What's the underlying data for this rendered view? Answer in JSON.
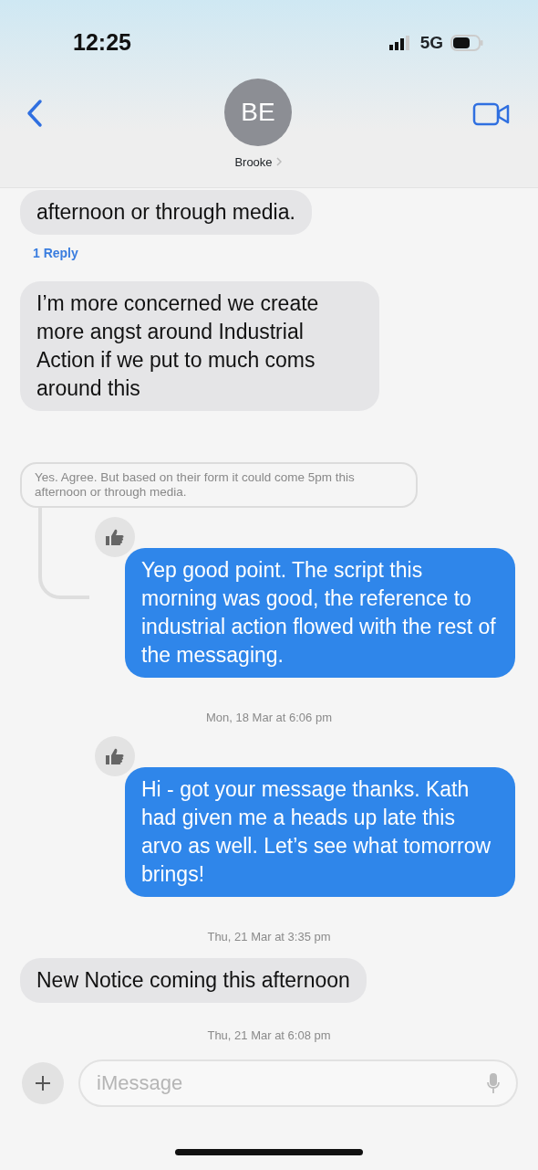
{
  "status_bar": {
    "time": "12:25",
    "network": "5G"
  },
  "header": {
    "initials": "BE",
    "name": "Brooke"
  },
  "messages": [
    {
      "kind": "received",
      "text": "afternoon or through media.",
      "reply_count": "1 Reply",
      "tapback": false,
      "threaded": false
    },
    {
      "kind": "received",
      "text": "I’m more concerned we create more angst around Industrial Action if we put to much coms around this",
      "tapback": false,
      "threaded": false
    },
    {
      "kind": "quote",
      "text": "Yes. Agree. But based on their form it could come 5pm this afternoon or through media."
    },
    {
      "kind": "sent",
      "text": "Yep good point. The script this morning was good, the reference to industrial action flowed with the rest of the messaging.",
      "tapback": true,
      "threaded": true
    },
    {
      "kind": "timestamp",
      "text": "Mon, 18 Mar at 6:06 pm"
    },
    {
      "kind": "sent",
      "text": "Hi - got your message thanks. Kath had given me a heads up late this arvo as well. Let’s see what tomorrow brings!",
      "tapback": true,
      "threaded": false
    },
    {
      "kind": "timestamp",
      "text": "Thu, 21 Mar at 3:35 pm"
    },
    {
      "kind": "received",
      "text": "New Notice coming this afternoon",
      "tapback": false,
      "threaded": false
    },
    {
      "kind": "timestamp",
      "text": "Thu, 21 Mar at 6:08 pm"
    }
  ],
  "composer": {
    "placeholder": "iMessage"
  }
}
